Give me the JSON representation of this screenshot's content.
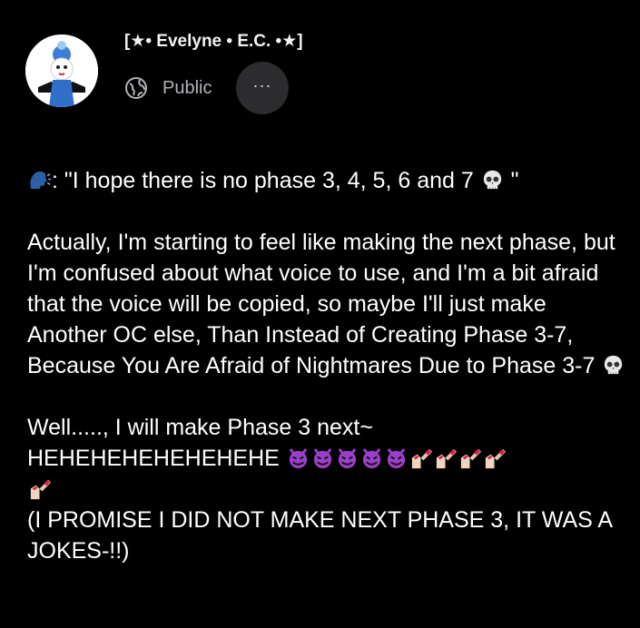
{
  "post": {
    "author_name": "[★• Evelyne • E.C. •★]",
    "privacy": "Public",
    "more_label": "···",
    "quote_prefix": ": \"I hope there is no phase 3, 4, 5, 6 and 7 ",
    "quote_suffix": " \"",
    "paragraph2_text": "Actually, I'm starting to feel like making the next phase, but I'm confused about what voice to use, and I'm a bit afraid that the voice will be copied, so maybe I'll just make Another OC else, Than Instead of Creating Phase 3-7, Because You Are Afraid of Nightmares Due to Phase 3-7 ",
    "paragraph3_line1": "Well....., I will make Phase 3 next~",
    "paragraph3_laugh": "HEHEHEHEHEHEHEHE ",
    "paragraph3_promise": "(I PROMISE I DID NOT MAKE NEXT PHASE 3, IT WAS A JOKES-!!)"
  },
  "icons": {
    "speaking_head": "speaking-head-icon",
    "skull": "skull-icon",
    "devil": "smiling-devil-icon",
    "nail_polish": "nail-polish-icon",
    "globe": "globe-icon"
  },
  "colors": {
    "background": "#000000",
    "text": "#ffffff",
    "secondary_text": "#b0b3b8",
    "button_bg": "#2c2c2e",
    "devil_purple": "#9b3fc9",
    "speaking_head_blue": "#2b5fa6"
  }
}
